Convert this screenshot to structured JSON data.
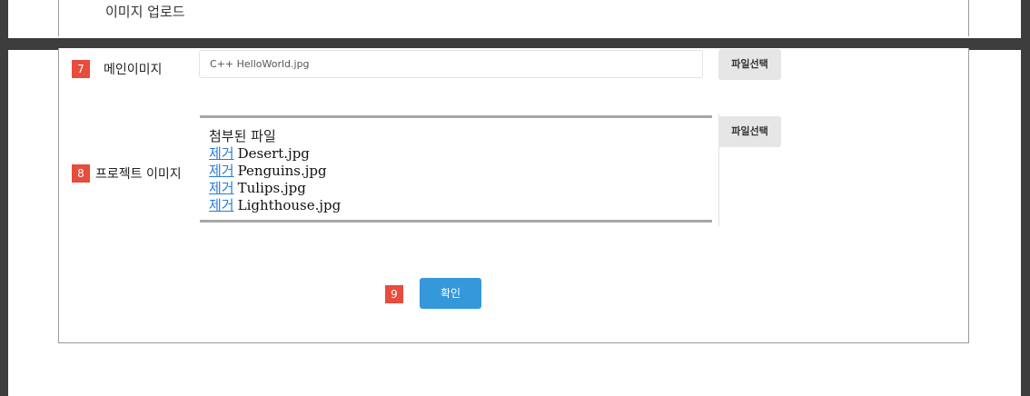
{
  "top": {
    "title": "이미지 업로드"
  },
  "main_image": {
    "badge": "7",
    "label": "메인이미지",
    "value": "C++ HelloWorld.jpg",
    "file_button": "파일선택"
  },
  "project_image": {
    "badge": "8",
    "label": "프로젝트 이미지",
    "file_button": "파일선택",
    "attached_title": "첨부된 파일",
    "remove_label": "제거",
    "files": [
      {
        "name": "Desert.jpg"
      },
      {
        "name": "Penguins.jpg"
      },
      {
        "name": "Tulips.jpg"
      },
      {
        "name": "Lighthouse.jpg"
      }
    ]
  },
  "confirm": {
    "badge": "9",
    "label": "확인"
  },
  "colors": {
    "badge": "#e74c3c",
    "primary": "#3498db",
    "link": "#2b7bd6",
    "background_dark": "#3d3d3d"
  }
}
